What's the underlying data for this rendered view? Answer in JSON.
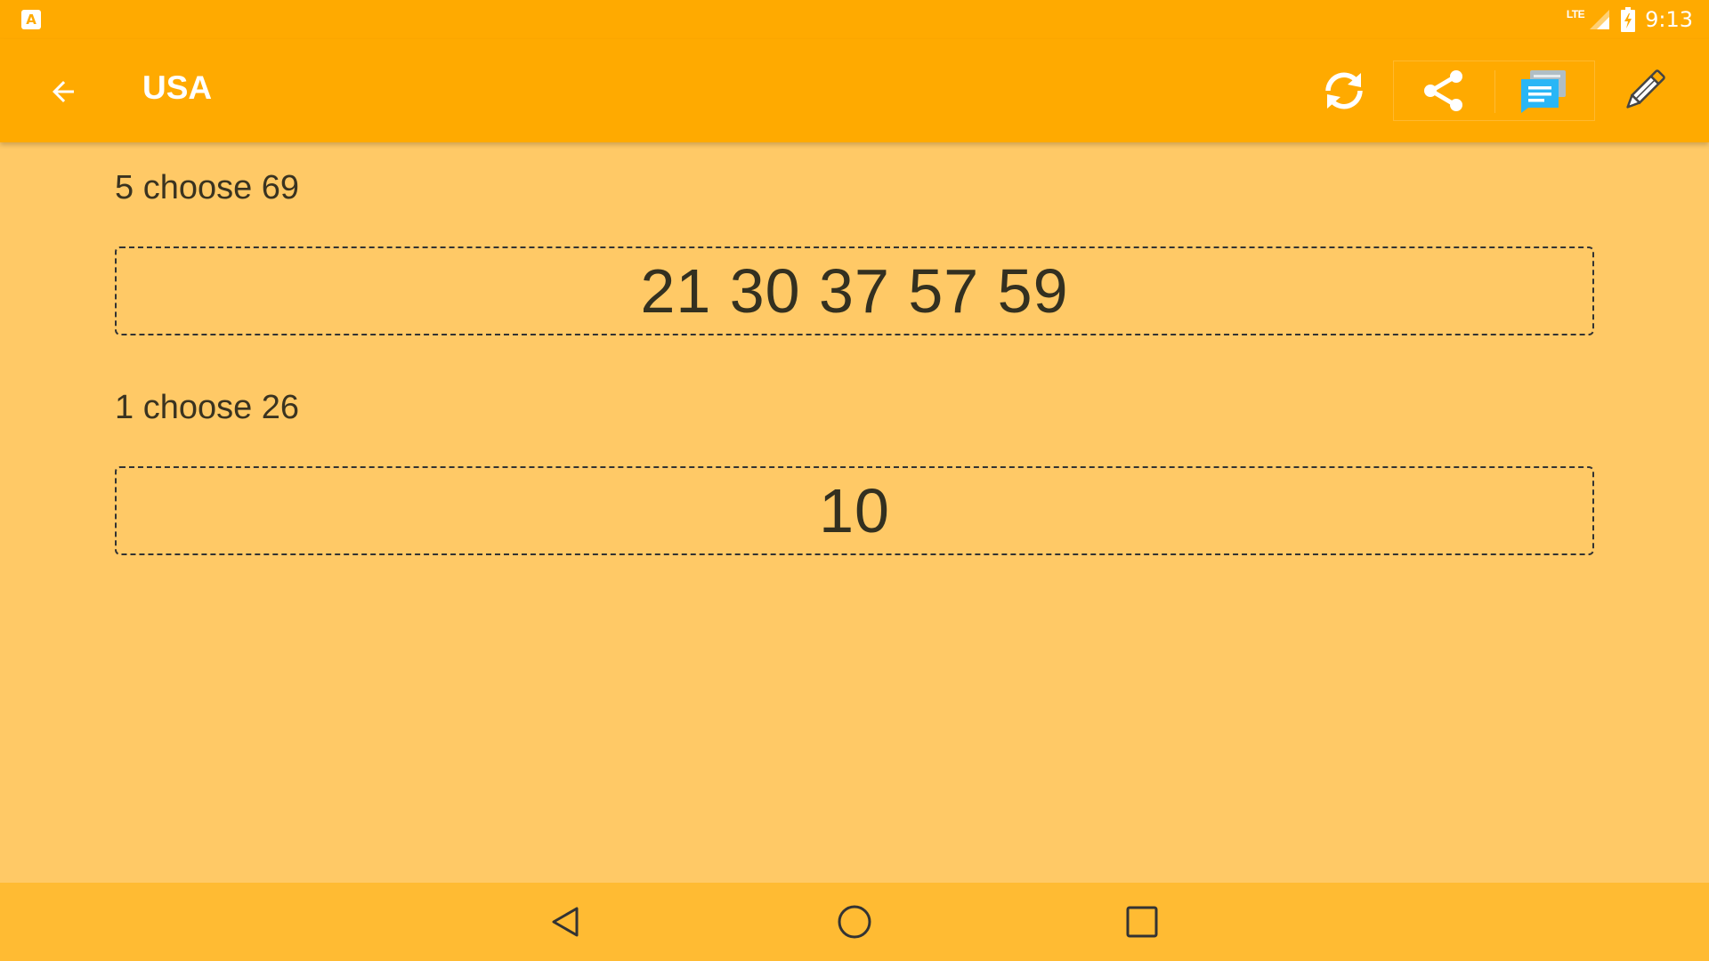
{
  "status_bar": {
    "app_icon_glyph": "A",
    "network_label": "LTE",
    "time": "9:13"
  },
  "app_bar": {
    "title": "USA",
    "icons": [
      "back-arrow-icon",
      "refresh-icon",
      "share-icon",
      "messaging-icon",
      "pencil-icon"
    ]
  },
  "draws": [
    {
      "label": "5 choose 69",
      "result": "21 30 37 57 59"
    },
    {
      "label": "1 choose 26",
      "result": "10"
    }
  ],
  "nav_bar": {
    "icons": [
      "nav-back-icon",
      "nav-home-icon",
      "nav-recents-icon"
    ]
  },
  "colors": {
    "app_bar": "#FFAA00",
    "background": "#FFC966",
    "nav_bar": "#FFBB33",
    "messaging_icon": "#29B6F6"
  }
}
